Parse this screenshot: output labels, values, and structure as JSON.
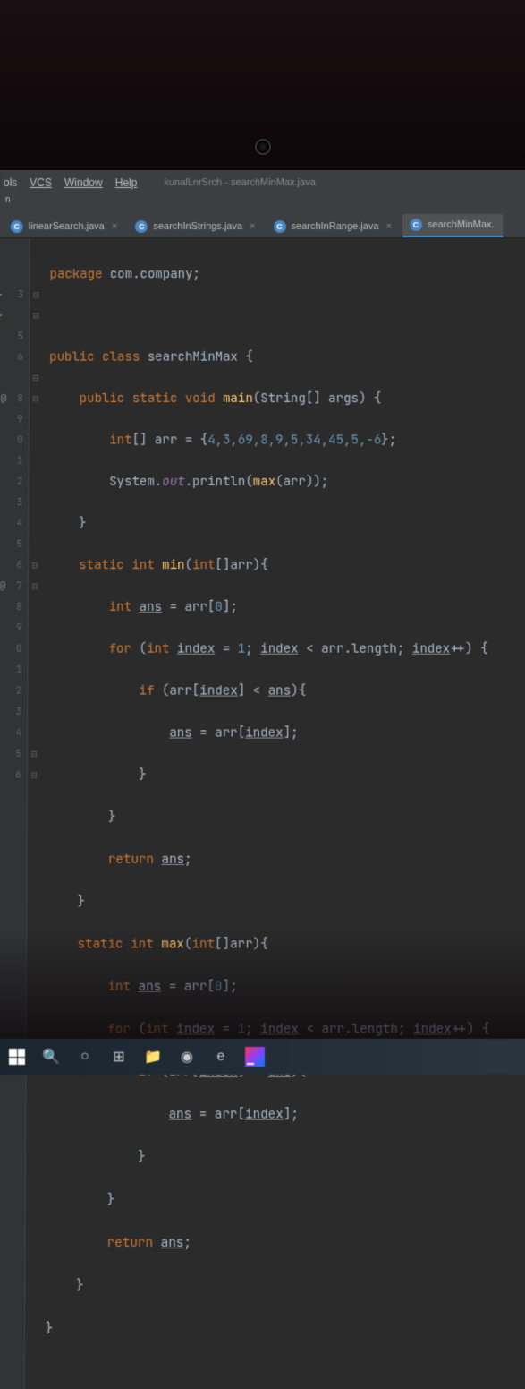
{
  "menubar": {
    "items": [
      "ols",
      "VCS",
      "Window",
      "Help"
    ],
    "project_title": "kunalLnrSrch - searchMinMax.java"
  },
  "sidebar_tag": "n",
  "tabs": [
    {
      "label": "linearSearch.java",
      "active": false
    },
    {
      "label": "searchInStrings.java",
      "active": false
    },
    {
      "label": "searchInRange.java",
      "active": false
    },
    {
      "label": "searchMinMax.",
      "active": true
    }
  ],
  "gutter_lines": [
    "",
    "",
    "3",
    "",
    "5",
    "6",
    "",
    "8",
    "9",
    "0",
    "1",
    "2",
    "3",
    "4",
    "5",
    "6",
    "7",
    "8",
    "9",
    "0",
    "1",
    "2",
    "3",
    "4",
    "5",
    "6",
    ""
  ],
  "code": {
    "l1_pkg": "package",
    "l1_ns": "com.company;",
    "l3_pub": "public class",
    "l3_name": "searchMinMax {",
    "l4_sig_a": "public static void",
    "l4_main": "main",
    "l4_sig_b": "(String[] args) {",
    "l5_a": "int",
    "l5_b": "[] arr = {",
    "l5_nums": "4,3,69,8,9,5,34,45,5,-6",
    "l5_c": "};",
    "l6_a": "System.",
    "l6_out": "out",
    "l6_b": ".println(",
    "l6_fn": "max",
    "l6_c": "(arr));",
    "l7_brace": "}",
    "l8_a": "static int",
    "l8_fn": "min",
    "l8_b": "(",
    "l8_c": "int",
    "l8_d": "[]arr){",
    "l9_a": "int",
    "l9_ans": "ans",
    "l9_b": " = arr[",
    "l9_n": "0",
    "l9_c": "];",
    "l10_for": "for",
    "l10_a": " (",
    "l10_int": "int",
    "l10_idx": "index",
    "l10_b": " = ",
    "l10_one": "1",
    "l10_c": "; ",
    "l10_idx2": "index",
    "l10_d": " < arr.length; ",
    "l10_idx3": "index",
    "l10_e": "++) {",
    "l11_if": "if",
    "l11_a": " (arr[",
    "l11_idx": "index",
    "l11_b": "] < ",
    "l11_ans": "ans",
    "l11_c": "){",
    "l12_ans": "ans",
    "l12_a": " = arr[",
    "l12_idx": "index",
    "l12_b": "];",
    "l13_brace": "}",
    "l14_brace": "}",
    "l15_ret": "return",
    "l15_ans": "ans",
    "l15_semi": ";",
    "l16_brace": "}",
    "l17_a": "static int",
    "l17_fn": "max",
    "l17_b": "(",
    "l17_c": "int",
    "l17_d": "[]arr){",
    "l18_a": "int",
    "l18_ans": "ans",
    "l18_b": " = arr[",
    "l18_n": "0",
    "l18_c": "];",
    "l19_for": "for",
    "l19_a": " (",
    "l19_int": "int",
    "l19_idx": "index",
    "l19_b": " = ",
    "l19_one": "1",
    "l19_c": "; ",
    "l19_idx2": "index",
    "l19_d": " < arr.length; ",
    "l19_idx3": "index",
    "l19_e": "++) {",
    "l20_if": "if",
    "l20_a": " (arr[",
    "l20_idx": "index",
    "l20_b": "] > ",
    "l20_ans": "ans",
    "l20_c": "){",
    "l21_ans": "ans",
    "l21_a": " = arr[",
    "l21_idx": "index",
    "l21_b": "];",
    "l22_brace": "}",
    "l23_brace": "}",
    "l24_ret": "return",
    "l24_ans": "ans",
    "l24_semi": ";",
    "l25_brace": "}",
    "l26_brace": "}"
  },
  "taskbar": {
    "search": "🔍",
    "cortana": "○",
    "tasks": "⊞",
    "folder": "📁",
    "chrome": "◉",
    "edge": "e"
  }
}
